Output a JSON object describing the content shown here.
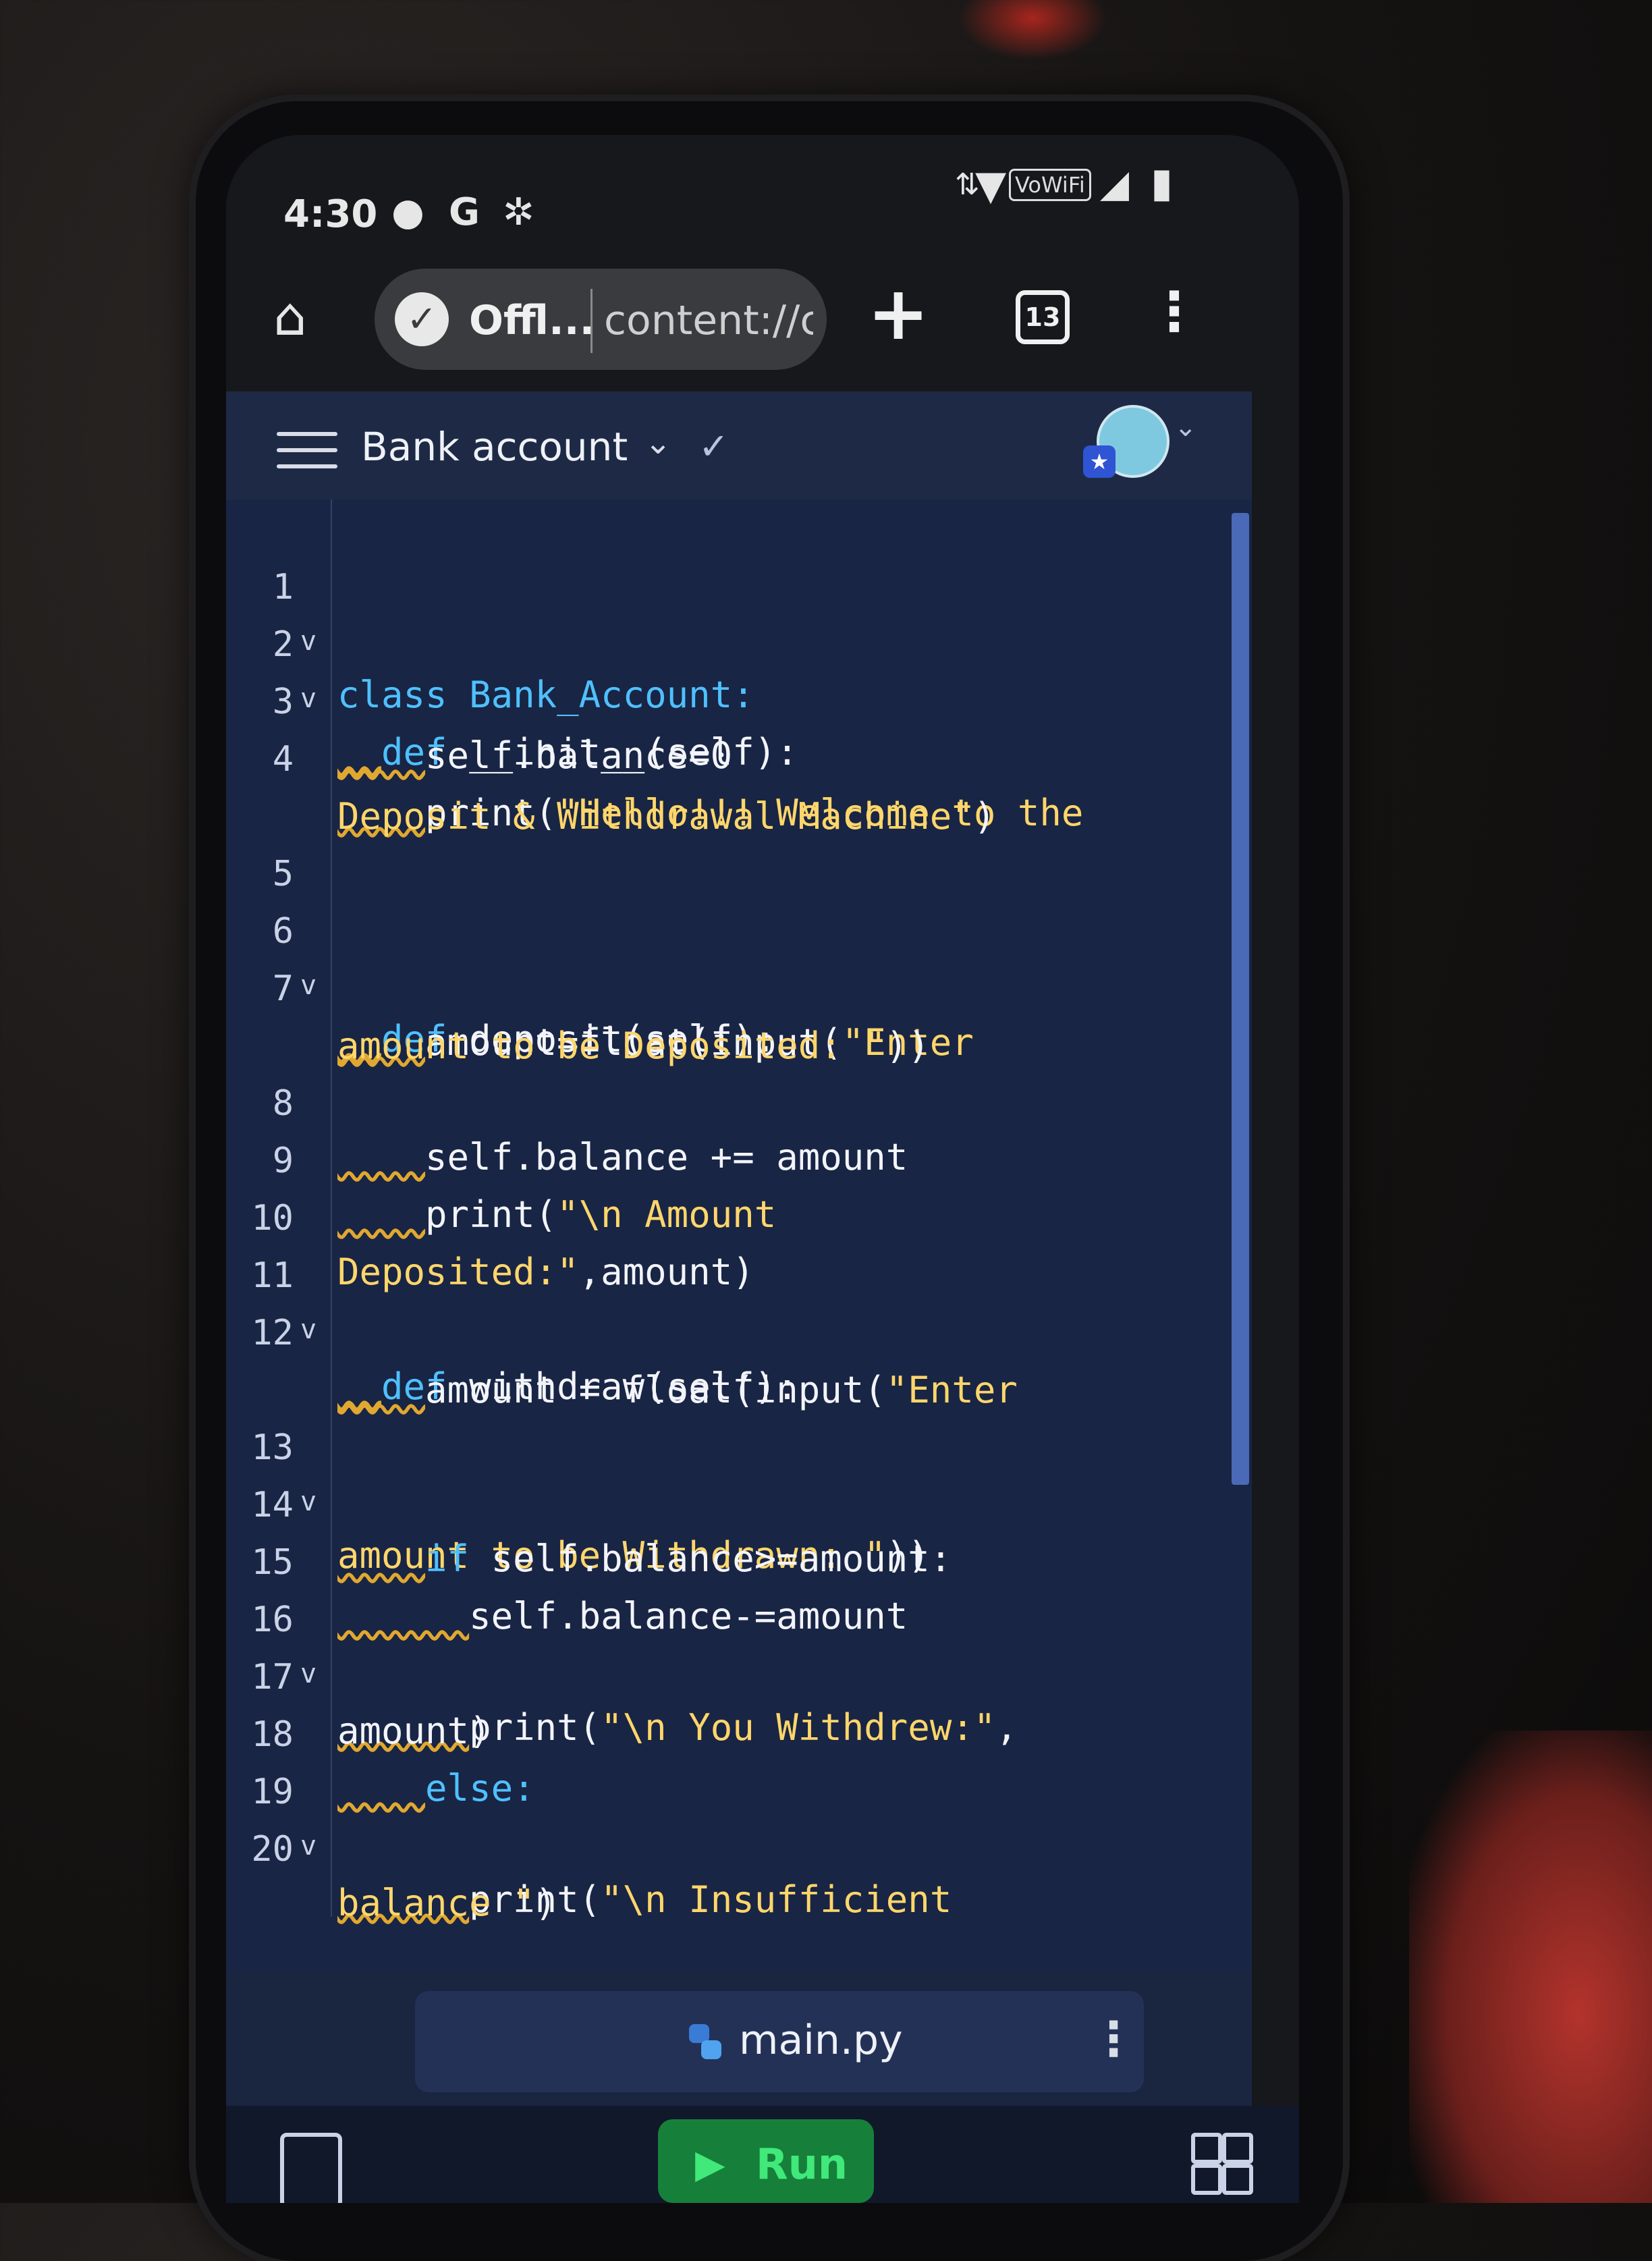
{
  "status_bar": {
    "time": "4:30",
    "icons": [
      "chat-bubble-icon",
      "google-icon",
      "gear-icon"
    ],
    "right_icons": [
      "data-arrows-icon",
      "wifi-icon",
      "signal-icon",
      "battery-icon"
    ],
    "vowifi": "VoWiFi"
  },
  "browser": {
    "offline_label": "Offl...",
    "url": "content://c",
    "tab_count": "13"
  },
  "header": {
    "title": "Bank account"
  },
  "code": {
    "lines": [
      {
        "n": "1",
        "fold": "v"
      },
      {
        "n": "2",
        "fold": "v"
      },
      {
        "n": "3",
        "fold": ""
      },
      {
        "n": "4",
        "fold": ""
      },
      {
        "n": "",
        "fold": ""
      },
      {
        "n": "5",
        "fold": ""
      },
      {
        "n": "6",
        "fold": "v"
      },
      {
        "n": "7",
        "fold": ""
      },
      {
        "n": "",
        "fold": ""
      },
      {
        "n": "8",
        "fold": ""
      },
      {
        "n": "9",
        "fold": ""
      },
      {
        "n": "10",
        "fold": ""
      },
      {
        "n": "11",
        "fold": "v"
      },
      {
        "n": "12",
        "fold": ""
      },
      {
        "n": "",
        "fold": ""
      },
      {
        "n": "13",
        "fold": "v"
      },
      {
        "n": "14",
        "fold": ""
      },
      {
        "n": "15",
        "fold": ""
      },
      {
        "n": "16",
        "fold": "v"
      },
      {
        "n": "17",
        "fold": ""
      },
      {
        "n": "18",
        "fold": ""
      },
      {
        "n": "19",
        "fold": "v"
      },
      {
        "n": "20",
        "fold": ""
      }
    ],
    "t": {
      "l1a": "class",
      "l1b": "Bank_Account:",
      "l2a": "def",
      "l2b": "__init__(self):",
      "l3": "self.balance=0",
      "l4a": "print(",
      "l4b": "\"Hello!!! Welcome to the",
      "l4c": "Deposit & Withdrawal Machine\"",
      "l4d": ")",
      "l6a": "def",
      "l6b": "deposit(self):",
      "l7a": "amount=float(input(",
      "l7b": "\"Enter",
      "l7c": "amount to be Deposited: \"",
      "l7d": "))",
      "l8": "self.balance += amount",
      "l9a": "print(",
      "l9b": "\"\\n Amount",
      "l10a": "Deposited:\"",
      "l10b": ",amount)",
      "l12a": "def",
      "l12b": "withdraw(self):",
      "l13a": "amount = float(input(",
      "l13b": "\"Enter",
      "l13c": "amount to be Withdrawn: \"",
      "l13d": "))",
      "l14a": "if",
      "l14b": "self.balance>=amount:",
      "l15": "self.balance-=amount",
      "l16a": "print(",
      "l16b": "\"\\n You Withdrew:\"",
      "l16c": ",",
      "l17": "amount)",
      "l18": "else:",
      "l19a": "print(",
      "l19b": "\"\\n Insufficient",
      "l20a": "balance \"",
      "l20b": ")"
    }
  },
  "file_tab": {
    "name": "main.py"
  },
  "bottom": {
    "run_label": "Run"
  }
}
